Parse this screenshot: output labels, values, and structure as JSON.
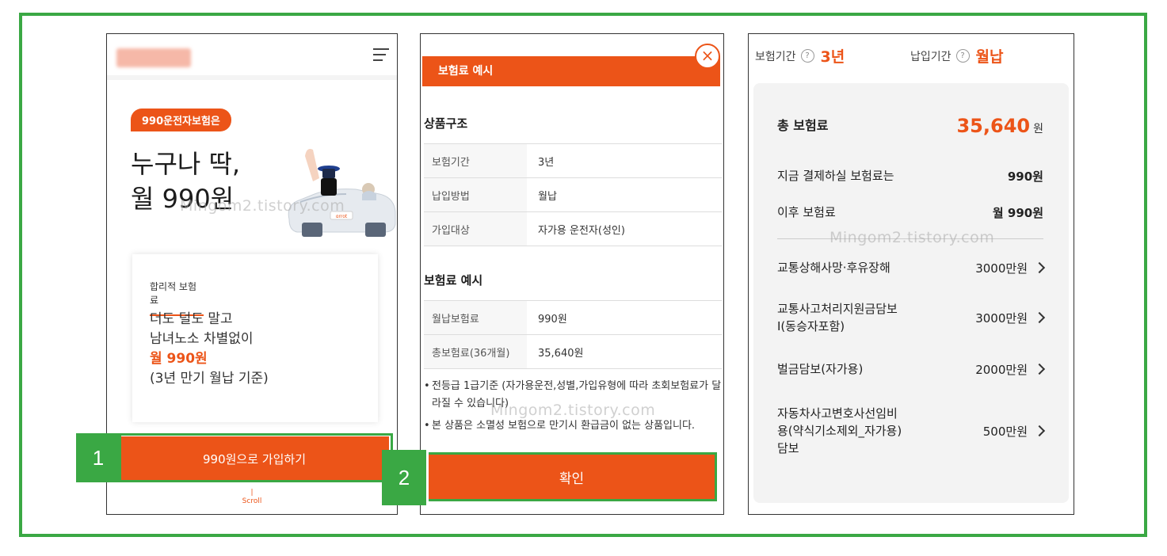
{
  "watermark": "Mingom2.tistory.com",
  "panel1": {
    "tag": "990운전자보험은",
    "headline_line1": "누구나 딱,",
    "headline_line2": "월 990원",
    "car_plate": "ɑrrot",
    "card_label": "합리적 보험료",
    "card_line1": "더도 덜도 말고",
    "card_line2": "남녀노소 차별없이",
    "card_price": "월 990원",
    "card_note": "(3년 만기 월납 기준)",
    "cta_label": "990원으로 가입하기",
    "scroll_label": "Scroll"
  },
  "panel2": {
    "header_title": "보험료 예시",
    "close_glyph": "×",
    "section1_title": "상품구조",
    "structure_rows": [
      {
        "key": "보험기간",
        "value": "3년"
      },
      {
        "key": "납입방법",
        "value": "월납"
      },
      {
        "key": "가입대상",
        "value": "자가용 운전자(성인)"
      }
    ],
    "section2_title": "보험료 예시",
    "premium_rows": [
      {
        "key": "월납보험료",
        "value": "990원"
      },
      {
        "key": "총보험료(36개월)",
        "value": "35,640원"
      }
    ],
    "note1": "전등급 1급기준 (자가용운전,성별,가입유형에 따라 초회보험료가 달라질 수 있습니다)",
    "note2": "본 상품은 소멸성 보험으로 만기시 환급금이 없는 상품입니다.",
    "confirm_label": "확인"
  },
  "panel3": {
    "period_label": "보험기간",
    "period_value": "3년",
    "payment_label": "납입기간",
    "payment_value": "월납",
    "help_glyph": "?",
    "total_label": "총 보험료",
    "total_value": "35,640",
    "total_unit": "원",
    "pay_now_label": "지금 결제하실 보험료는",
    "pay_now_value": "990원",
    "after_label": "이후 보험료",
    "after_value": "월 990원",
    "coverages": [
      {
        "label": "교통상해사망·후유장해",
        "amount": "3000만원"
      },
      {
        "label_line1": "교통사고처리지원금담보",
        "label_line2": "Ⅰ(동승자포함)",
        "amount": "3000만원"
      },
      {
        "label": "벌금담보(자가용)",
        "amount": "2000만원"
      },
      {
        "label_line1": "자동차사고변호사선임비",
        "label_line2": "용(약식기소제외_자가용)",
        "label_line3": "담보",
        "amount": "500만원"
      }
    ]
  },
  "steps": [
    "1",
    "2"
  ],
  "colors": {
    "accent": "#ec5418",
    "frame_green": "#3aa844"
  }
}
